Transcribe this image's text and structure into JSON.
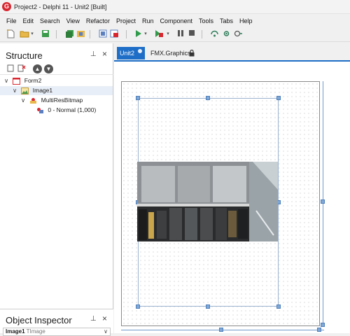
{
  "titlebar": {
    "title": "Project2 - Delphi 11 - Unit2 [Built]",
    "app_icon_glyph": "G"
  },
  "menubar": {
    "items": [
      "File",
      "Edit",
      "Search",
      "View",
      "Refactor",
      "Project",
      "Run",
      "Component",
      "Tools",
      "Tabs",
      "Help"
    ]
  },
  "toolbar": {
    "icons": [
      "new-file-icon",
      "open-folder-icon",
      "save-icon",
      "save-all-icon",
      "open-project-icon",
      "add-file-icon",
      "remove-file-icon",
      "run-icon",
      "run-dropdown-icon",
      "run-without-debug-icon",
      "run-without-debug-dropdown-icon",
      "pause-icon",
      "stop-icon",
      "step-over-icon",
      "trace-into-icon",
      "run-to-cursor-icon"
    ]
  },
  "structure": {
    "title": "Structure",
    "pin_glyph": "⊥",
    "close_glyph": "×",
    "tree": [
      {
        "label": "Form2",
        "level": 0,
        "icon": "form-icon"
      },
      {
        "label": "Image1",
        "level": 1,
        "icon": "image-component-icon"
      },
      {
        "label": "MultiResBitmap",
        "level": 2,
        "icon": "multiresbitmap-icon"
      },
      {
        "label": "0 - Normal (1,000)",
        "level": 3,
        "icon": "bitmap-item-icon"
      }
    ]
  },
  "object_inspector": {
    "title": "Object Inspector",
    "selected_object": "Image1",
    "selected_type": "TImage",
    "pin_glyph": "⊥",
    "close_glyph": "×"
  },
  "editor_tabs": {
    "tabs": [
      {
        "label": "Unit2",
        "active": true
      },
      {
        "label": "FMX.Graphics",
        "active": false,
        "locked": true
      }
    ]
  },
  "colors": {
    "accent": "#1e6ec8",
    "menu_bg": "#f0f0f0",
    "selection_handle": "#7fa8d8"
  }
}
